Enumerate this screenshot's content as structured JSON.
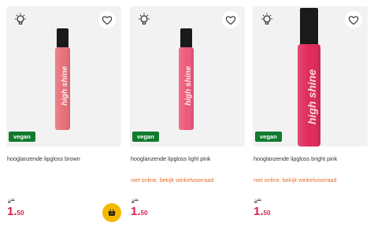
{
  "products": [
    {
      "title": "hooglanzende lipgloss brown",
      "badge": "vegan",
      "stock_note": "",
      "old_price_int": "3",
      "old_price_dec": "25",
      "price_int": "1.",
      "price_dec": "50",
      "gloss_color": "#e8707a",
      "cap_color": "#1a1a1a",
      "label_text": "high shine",
      "has_basket": true
    },
    {
      "title": "hooglanzende lipgloss light pink",
      "badge": "vegan",
      "stock_note": "niet online, bekijk winkelvoorraad",
      "old_price_int": "3",
      "old_price_dec": "25",
      "price_int": "1.",
      "price_dec": "50",
      "gloss_color": "#ee5a7a",
      "cap_color": "#1a1a1a",
      "label_text": "high shine",
      "has_basket": false
    },
    {
      "title": "hooglanzende lipgloss bright pink",
      "badge": "vegan",
      "stock_note": "niet online, bekijk winkelvoorraad",
      "old_price_int": "3",
      "old_price_dec": "25",
      "price_int": "1.",
      "price_dec": "50",
      "gloss_color": "#e02a5a",
      "cap_color": "#1a1a1a",
      "label_text": "high shine",
      "has_basket": false
    }
  ],
  "colors": {
    "price_red": "#d8204b",
    "stock_orange": "#e8702a",
    "vegan_green": "#117a2e",
    "basket_yellow": "#f5b800"
  },
  "icons": {
    "bulb": "lightbulb-icon",
    "heart": "heart-icon",
    "basket": "shopping-basket-icon"
  }
}
